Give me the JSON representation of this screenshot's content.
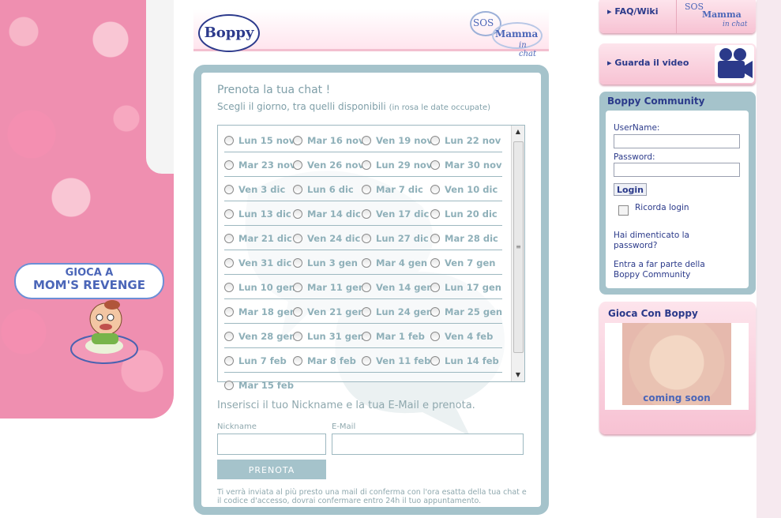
{
  "header": {
    "logo_text": "Boppy",
    "sos_line1": "SOS",
    "sos_line2": "Mamma",
    "sos_line3": "in chat"
  },
  "left": {
    "game_line1": "GIOCA A",
    "game_line2": "MOM'S REVENGE"
  },
  "booking": {
    "title": "Prenota la tua chat !",
    "subtitle": "Scegli il giorno, tra quelli disponibili",
    "subtitle_note": "(in rosa le date occupate)",
    "dates": [
      [
        "Lun 15 nov",
        "Mar 16 nov",
        "Ven 19 nov",
        "Lun 22 nov"
      ],
      [
        "Mar 23 nov",
        "Ven 26 nov",
        "Lun 29 nov",
        "Mar 30 nov"
      ],
      [
        "Ven 3 dic",
        "Lun 6 dic",
        "Mar 7 dic",
        "Ven 10 dic"
      ],
      [
        "Lun 13 dic",
        "Mar 14 dic",
        "Ven 17 dic",
        "Lun 20 dic"
      ],
      [
        "Mar 21 dic",
        "Ven 24 dic",
        "Lun 27 dic",
        "Mar 28 dic"
      ],
      [
        "Ven 31 dic",
        "Lun 3 gen",
        "Mar 4 gen",
        "Ven 7 gen"
      ],
      [
        "Lun 10 gen",
        "Mar 11 gen",
        "Ven 14 gen",
        "Lun 17 gen"
      ],
      [
        "Mar 18 gen",
        "Ven 21 gen",
        "Lun 24 gen",
        "Mar 25 gen"
      ],
      [
        "Ven 28 gen",
        "Lun 31 gen",
        "Mar 1 feb",
        "Ven 4 feb"
      ],
      [
        "Lun 7 feb",
        "Mar 8 feb",
        "Ven 11 feb",
        "Lun 14 feb"
      ],
      [
        "Mar 15 feb"
      ]
    ],
    "insert_text": "Inserisci il tuo Nickname e la tua E-Mail e prenota.",
    "nickname_label": "Nickname",
    "email_label": "E-Mail",
    "nickname_value": "",
    "email_value": "",
    "submit_label": "PRENOTA",
    "footnote": "Ti verrà inviata al più presto una mail di conferma con l'ora esatta della tua chat e il codice d'accesso, dovrai confermare entro 24h il tuo appuntamento."
  },
  "sidebar": {
    "faq_label": "FAQ/Wiki",
    "video_label": "Guarda il video",
    "community_title": "Boppy Community",
    "username_label": "UserName:",
    "password_label": "Password:",
    "username_value": "",
    "password_value": "",
    "login_label": "Login",
    "remember_label": "Ricorda login",
    "forgot_label": "Hai dimenticato la password?",
    "join_label": "Entra a far parte della Boppy Community",
    "gioca_title": "Gioca Con Boppy",
    "coming_soon": "coming soon"
  }
}
